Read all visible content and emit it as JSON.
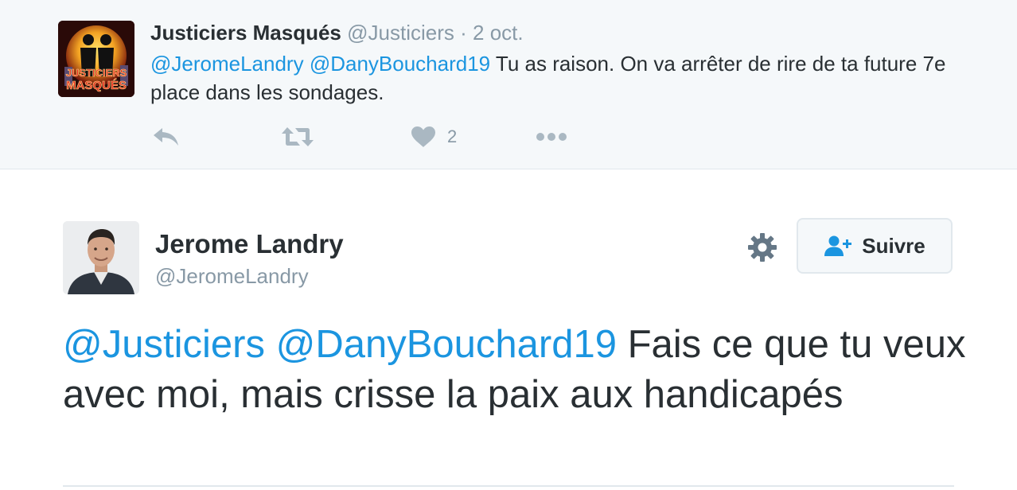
{
  "parent_tweet": {
    "author_name": "Justiciers Masqués",
    "handle": "@Justiciers",
    "separator": "·",
    "date": "2 oct.",
    "mention1": "@JeromeLandry",
    "mention2": "@DanyBouchard19",
    "text": "Tu as raison. On va arrêter de rire de ta future 7e place dans les sondages.",
    "avatar_logo_text": [
      "JUSTICIERS",
      "MASQUÉS"
    ],
    "like_count": "2",
    "icons": [
      "reply-icon",
      "retweet-icon",
      "heart-icon",
      "more-icon"
    ]
  },
  "main_tweet": {
    "author_name": "Jerome Landry",
    "handle": "@JeromeLandry",
    "follow_label": "Suivre",
    "mention1": "@Justiciers",
    "mention2": "@DanyBouchard19",
    "text": "Fais ce que tu veux avec moi, mais crisse la paix aux handicapés",
    "icons": [
      "gear-icon",
      "add-user-icon"
    ]
  },
  "colors": {
    "link": "#1b95e0",
    "text": "#292f33",
    "muted": "#8899a6",
    "icon": "#aab8c2",
    "parent_bg": "#f5f8fa",
    "border": "#e1e8ed"
  }
}
